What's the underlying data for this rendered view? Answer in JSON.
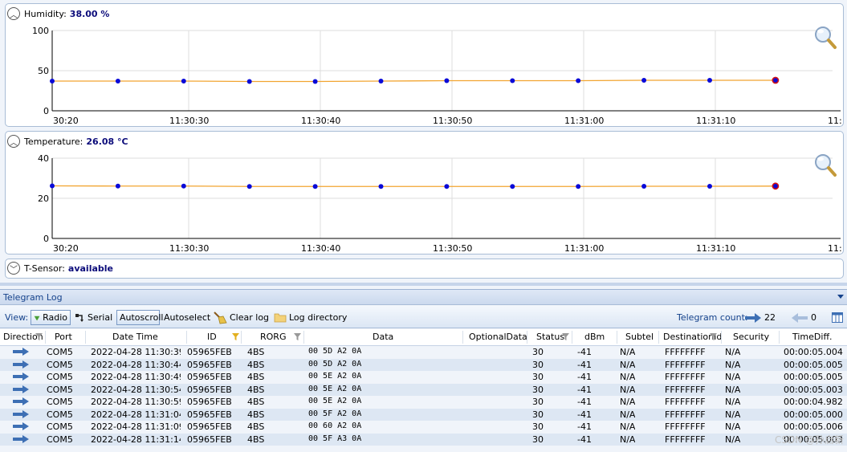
{
  "humidity": {
    "label": "Humidity:",
    "value": "38.00 %",
    "chart_data": {
      "type": "line",
      "y_ticks": [
        "100",
        "50",
        "0"
      ],
      "ylim": [
        0,
        100
      ],
      "x_ticks": [
        "30:20",
        "11:30:30",
        "11:30:40",
        "11:30:50",
        "11:31:00",
        "11:31:10",
        "11:"
      ],
      "values": [
        37,
        37,
        37,
        36.5,
        36.5,
        37,
        37.5,
        37.5,
        37.5,
        38,
        38,
        38
      ],
      "grid": true,
      "line_color": "#f2a531",
      "point_color": "#0a0ad8",
      "last_point_color": "#d41010"
    }
  },
  "temperature": {
    "label": "Temperature:",
    "value": "26.08 °C",
    "chart_data": {
      "type": "line",
      "y_ticks": [
        "40",
        "20",
        "0"
      ],
      "ylim": [
        0,
        40
      ],
      "x_ticks": [
        "30:20",
        "11:30:30",
        "11:30:40",
        "11:30:50",
        "11:31:00",
        "11:31:10",
        "11:"
      ],
      "values": [
        26.2,
        26.1,
        26.1,
        25.9,
        25.9,
        25.9,
        25.9,
        25.9,
        25.9,
        26.0,
        26.0,
        26.08
      ],
      "grid": true,
      "line_color": "#f2a531",
      "point_color": "#0a0ad8",
      "last_point_color": "#d41010"
    }
  },
  "sensor": {
    "label": "T-Sensor:",
    "value": "available"
  },
  "log": {
    "title": "Telegram Log",
    "view_label": "View:",
    "radio_label": "Radio",
    "serial_label": "Serial",
    "autoscroll_label": "Autoscroll",
    "autoselect_label": "Autoselect",
    "clear_label": "Clear log",
    "directory_label": "Log directory",
    "count_label": "Telegram count:",
    "in_count": "22",
    "out_count": "0"
  },
  "columns": [
    "Direction",
    "Port",
    "Date Time",
    "ID",
    "RORG",
    "Data",
    "OptionalData",
    "Status",
    "dBm",
    "Subtel",
    "DestinationId",
    "Security",
    "TimeDiff."
  ],
  "rows": [
    {
      "port": "COM5",
      "datetime": "2022-04-28 11:30:39.",
      "id": "05965FEB",
      "rorg": "4BS",
      "data": "00 5D A2 0A",
      "status": "30",
      "dbm": "-41",
      "subtel": "N/A",
      "dest": "FFFFFFFF",
      "security": "N/A",
      "diff": "00:00:05.004"
    },
    {
      "port": "COM5",
      "datetime": "2022-04-28 11:30:44.",
      "id": "05965FEB",
      "rorg": "4BS",
      "data": "00 5D A2 0A",
      "status": "30",
      "dbm": "-41",
      "subtel": "N/A",
      "dest": "FFFFFFFF",
      "security": "N/A",
      "diff": "00:00:05.005"
    },
    {
      "port": "COM5",
      "datetime": "2022-04-28 11:30:49.",
      "id": "05965FEB",
      "rorg": "4BS",
      "data": "00 5E A2 0A",
      "status": "30",
      "dbm": "-41",
      "subtel": "N/A",
      "dest": "FFFFFFFF",
      "security": "N/A",
      "diff": "00:00:05.005"
    },
    {
      "port": "COM5",
      "datetime": "2022-04-28 11:30:54.",
      "id": "05965FEB",
      "rorg": "4BS",
      "data": "00 5E A2 0A",
      "status": "30",
      "dbm": "-41",
      "subtel": "N/A",
      "dest": "FFFFFFFF",
      "security": "N/A",
      "diff": "00:00:05.003"
    },
    {
      "port": "COM5",
      "datetime": "2022-04-28 11:30:59.",
      "id": "05965FEB",
      "rorg": "4BS",
      "data": "00 5E A2 0A",
      "status": "30",
      "dbm": "-41",
      "subtel": "N/A",
      "dest": "FFFFFFFF",
      "security": "N/A",
      "diff": "00:00:04.982"
    },
    {
      "port": "COM5",
      "datetime": "2022-04-28 11:31:04.",
      "id": "05965FEB",
      "rorg": "4BS",
      "data": "00 5F A2 0A",
      "status": "30",
      "dbm": "-41",
      "subtel": "N/A",
      "dest": "FFFFFFFF",
      "security": "N/A",
      "diff": "00:00:05.000"
    },
    {
      "port": "COM5",
      "datetime": "2022-04-28 11:31:09.",
      "id": "05965FEB",
      "rorg": "4BS",
      "data": "00 60 A2 0A",
      "status": "30",
      "dbm": "-41",
      "subtel": "N/A",
      "dest": "FFFFFFFF",
      "security": "N/A",
      "diff": "00:00:05.006"
    },
    {
      "port": "COM5",
      "datetime": "2022-04-28 11:31:14.",
      "id": "05965FEB",
      "rorg": "4BS",
      "data": "00 5F A3 0A",
      "status": "30",
      "dbm": "-41",
      "subtel": "N/A",
      "dest": "FFFFFFFF",
      "security": "N/A",
      "diff": "00:00:05.003"
    }
  ],
  "watermark": "CSDN @孙启新"
}
